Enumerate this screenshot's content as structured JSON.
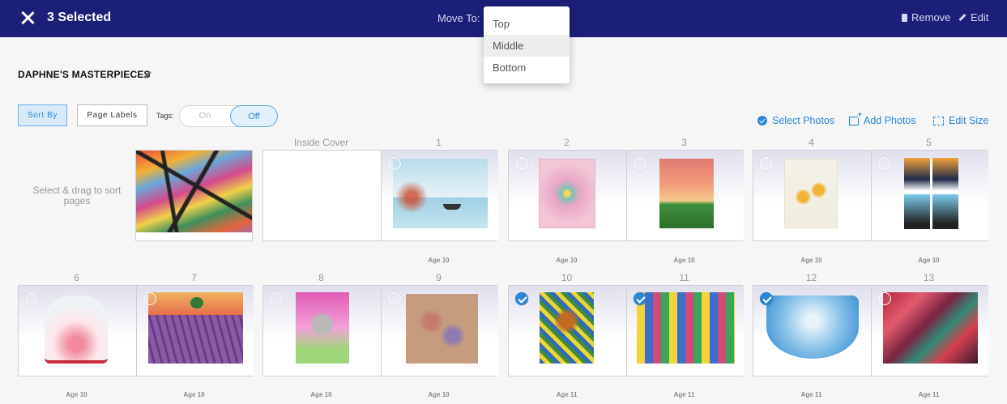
{
  "topbar": {
    "selected_label": "3 Selected",
    "move_to_label": "Move To:",
    "remove_label": "Remove",
    "edit_label": "Edit",
    "bg_color": "#1b1f78"
  },
  "dropdown": {
    "options": [
      "Top",
      "Middle",
      "Bottom"
    ],
    "highlighted": "Middle"
  },
  "book": {
    "title": "DAPHNE'S MASTERPIECES"
  },
  "controls": {
    "sort_by": "Sort By",
    "page_labels": "Page Labels",
    "tags_label": "Tags:",
    "toggle_on": "On",
    "toggle_off": "Off",
    "select_photos": "Select Photos",
    "add_photos": "Add Photos",
    "edit_size": "Edit Size",
    "accent_color": "#2a86d4"
  },
  "helper_text": "Select & drag to sort pages",
  "inside_cover_label": "Inside Cover",
  "pages": [
    {
      "num": "1",
      "age": "Age 10",
      "selected": false,
      "art": "lake-boat"
    },
    {
      "num": "2",
      "age": "Age 10",
      "selected": false,
      "art": "flower-pink"
    },
    {
      "num": "3",
      "age": "Age 10",
      "selected": false,
      "art": "sunset-cactus"
    },
    {
      "num": "4",
      "age": "Age 10",
      "selected": false,
      "art": "yellow-flowers"
    },
    {
      "num": "5",
      "age": "Age 10",
      "selected": false,
      "art": "city-skylines"
    },
    {
      "num": "6",
      "age": "Age 10",
      "selected": false,
      "art": "glass-bell"
    },
    {
      "num": "7",
      "age": "Age 10",
      "selected": false,
      "art": "lavender-field"
    },
    {
      "num": "8",
      "age": "Age 10",
      "selected": false,
      "art": "masked-face"
    },
    {
      "num": "9",
      "age": "Age 10",
      "selected": false,
      "art": "scissors"
    },
    {
      "num": "10",
      "age": "Age 11",
      "selected": true,
      "art": "butterfly"
    },
    {
      "num": "11",
      "age": "Age 11",
      "selected": true,
      "art": "mosaic"
    },
    {
      "num": "12",
      "age": "Age 11",
      "selected": true,
      "art": "blue-bowl"
    },
    {
      "num": "13",
      "age": "Age 11",
      "selected": false,
      "art": "red-geometry"
    }
  ]
}
